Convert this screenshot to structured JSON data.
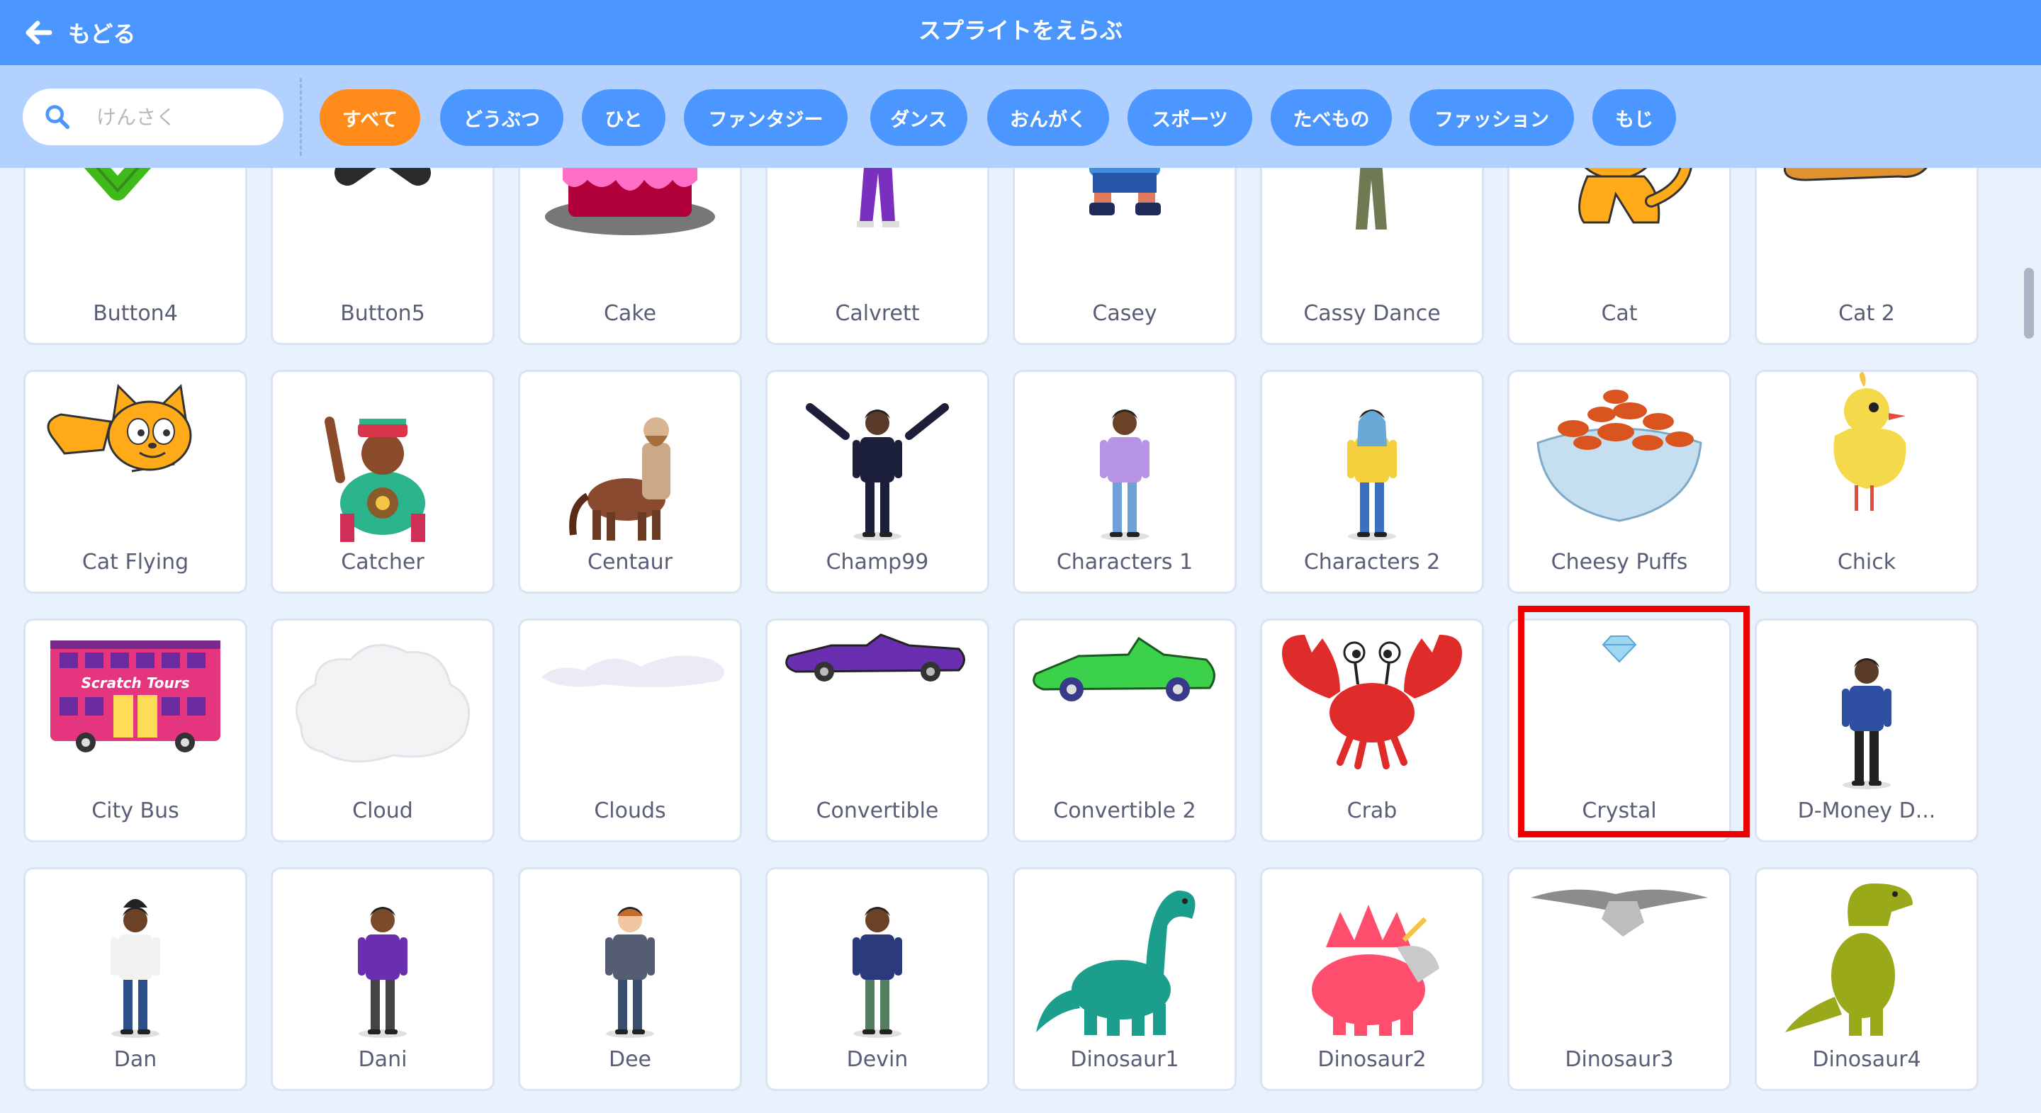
{
  "header": {
    "back_label": "もどる",
    "title": "スプライトをえらぶ"
  },
  "search": {
    "placeholder": "けんさく",
    "value": ""
  },
  "tags": [
    "すべて",
    "どうぶつ",
    "ひと",
    "ファンタジー",
    "ダンス",
    "おんがく",
    "スポーツ",
    "たべもの",
    "ファッション",
    "もじ"
  ],
  "active_tag": "すべて",
  "sprites": [
    {
      "name": "Button4"
    },
    {
      "name": "Button5"
    },
    {
      "name": "Cake"
    },
    {
      "name": "Calvrett"
    },
    {
      "name": "Casey"
    },
    {
      "name": "Cassy Dance"
    },
    {
      "name": "Cat"
    },
    {
      "name": "Cat 2"
    },
    {
      "name": "Cat Flying"
    },
    {
      "name": "Catcher"
    },
    {
      "name": "Centaur"
    },
    {
      "name": "Champ99"
    },
    {
      "name": "Characters 1"
    },
    {
      "name": "Characters 2"
    },
    {
      "name": "Cheesy Puffs"
    },
    {
      "name": "Chick"
    },
    {
      "name": "City Bus"
    },
    {
      "name": "Cloud"
    },
    {
      "name": "Clouds"
    },
    {
      "name": "Convertible"
    },
    {
      "name": "Convertible 2"
    },
    {
      "name": "Crab"
    },
    {
      "name": "Crystal"
    },
    {
      "name": "D-Money D..."
    },
    {
      "name": "Dan"
    },
    {
      "name": "Dani"
    },
    {
      "name": "Dee"
    },
    {
      "name": "Devin"
    },
    {
      "name": "Dinosaur1"
    },
    {
      "name": "Dinosaur2"
    },
    {
      "name": "Dinosaur3"
    },
    {
      "name": "Dinosaur4"
    }
  ],
  "highlighted_sprite": "Crystal",
  "colors": {
    "header": "#4c97ff",
    "filter_bar": "#b3d1ff",
    "active_tag": "#ff8c1a",
    "tag": "#4c97ff",
    "highlight": "#ee0000"
  }
}
